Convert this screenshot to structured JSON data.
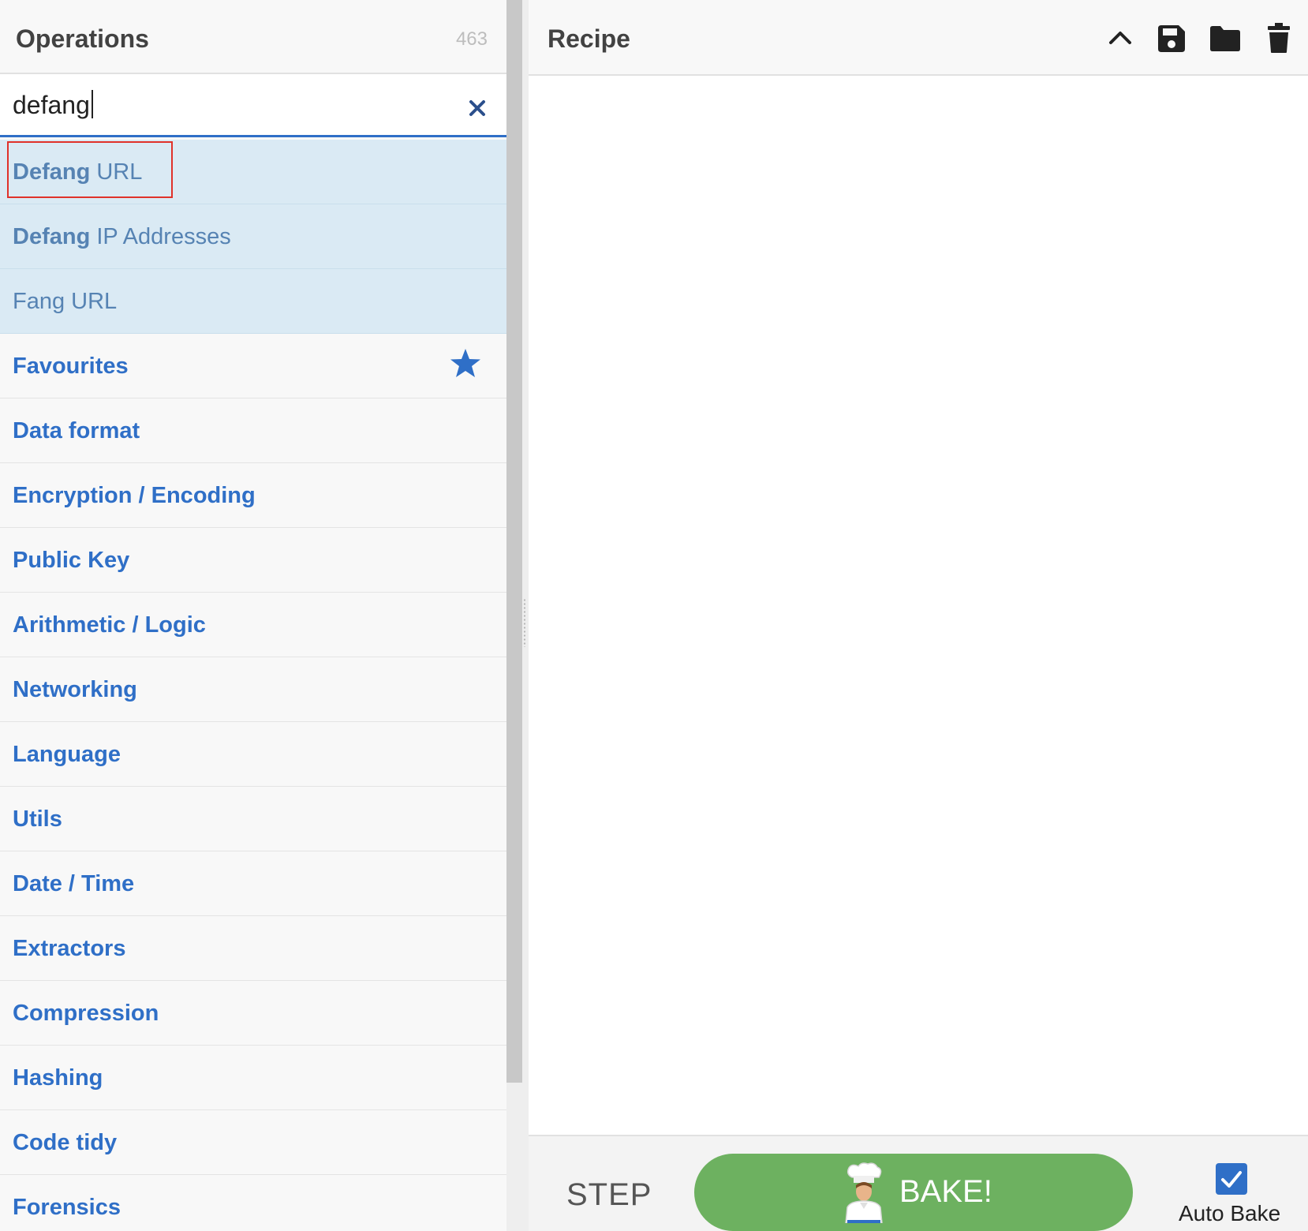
{
  "operations": {
    "title": "Operations",
    "count": "463",
    "search": {
      "value": "defang",
      "placeholder": "Search..."
    },
    "results": [
      {
        "highlight": "Defang",
        "rest": " URL"
      },
      {
        "highlight": "Defang",
        "rest": " IP Addresses"
      },
      {
        "highlight": "",
        "rest": "Fang URL"
      }
    ],
    "categories": [
      "Favourites",
      "Data format",
      "Encryption / Encoding",
      "Public Key",
      "Arithmetic / Logic",
      "Networking",
      "Language",
      "Utils",
      "Date / Time",
      "Extractors",
      "Compression",
      "Hashing",
      "Code tidy",
      "Forensics"
    ]
  },
  "recipe": {
    "title": "Recipe",
    "icons": [
      "chevron-up-icon",
      "save-icon",
      "folder-icon",
      "trash-icon"
    ]
  },
  "controls": {
    "step_label": "STEP",
    "bake_label": "BAKE!",
    "auto_bake_label": "Auto Bake",
    "auto_bake_checked": true
  },
  "colors": {
    "accent": "#2f6fc7",
    "bake_green": "#6db160",
    "result_bg": "#daeaf4"
  }
}
